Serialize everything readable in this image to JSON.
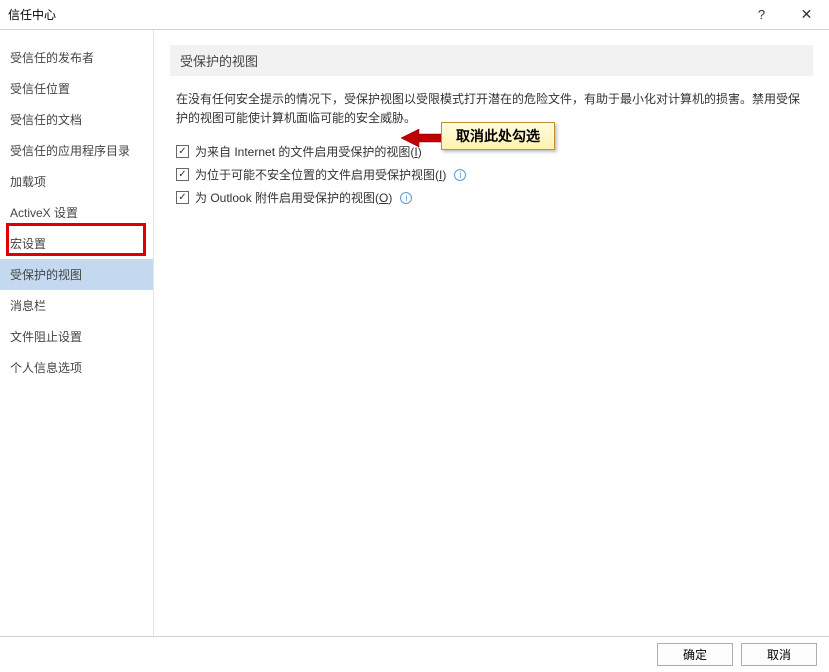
{
  "window": {
    "title": "信任中心",
    "help": "?",
    "close": "✕"
  },
  "sidebar": {
    "items": [
      {
        "label": "受信任的发布者"
      },
      {
        "label": "受信任位置"
      },
      {
        "label": "受信任的文档"
      },
      {
        "label": "受信任的应用程序目录"
      },
      {
        "label": "加载项"
      },
      {
        "label": "ActiveX 设置"
      },
      {
        "label": "宏设置"
      },
      {
        "label": "受保护的视图"
      },
      {
        "label": "消息栏"
      },
      {
        "label": "文件阻止设置"
      },
      {
        "label": "个人信息选项"
      }
    ],
    "selectedIndex": "7"
  },
  "main": {
    "sectionTitle": "受保护的视图",
    "description": "在没有任何安全提示的情况下，受保护视图以受限模式打开潜在的危险文件，有助于最小化对计算机的损害。禁用受保护的视图可能使计算机面临可能的安全威胁。",
    "options": [
      {
        "label_pre": "为来自 Internet 的文件启用受保护的视图(",
        "shortcut": "I",
        "label_post": ")",
        "checked": true,
        "hasInfo": false
      },
      {
        "label_pre": "为位于可能不安全位置的文件启用受保护视图(",
        "shortcut": "I",
        "label_post": ")",
        "checked": true,
        "hasInfo": true
      },
      {
        "label_pre": "为 Outlook 附件启用受保护的视图(",
        "shortcut": "O",
        "label_post": ")",
        "checked": true,
        "hasInfo": true
      }
    ]
  },
  "callout": {
    "text": "取消此处勾选"
  },
  "footer": {
    "ok": "确定",
    "cancel": "取消"
  }
}
